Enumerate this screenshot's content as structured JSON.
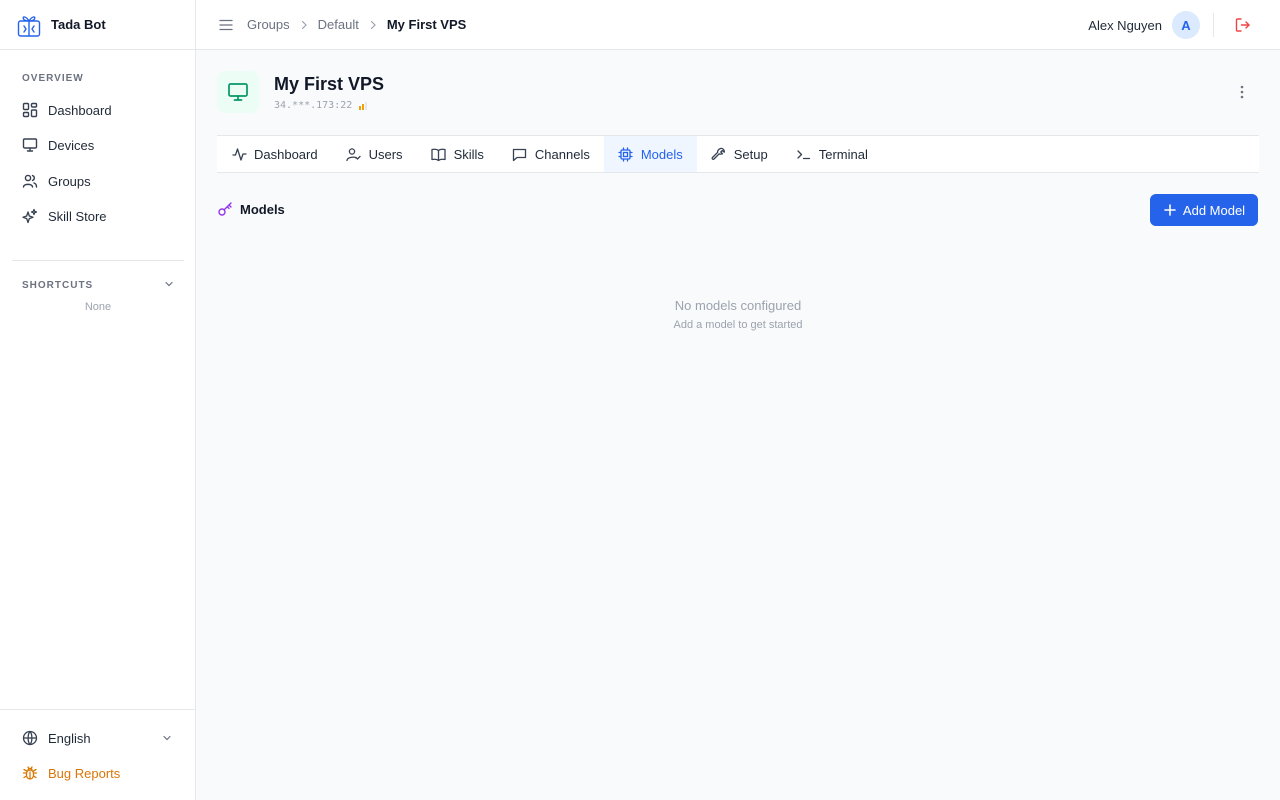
{
  "app": {
    "name": "Tada Bot"
  },
  "sidebar": {
    "overview_label": "OVERVIEW",
    "items": [
      {
        "label": "Dashboard",
        "icon": "dashboard-grid-icon"
      },
      {
        "label": "Devices",
        "icon": "monitor-icon"
      },
      {
        "label": "Groups",
        "icon": "users-icon"
      },
      {
        "label": "Skill Store",
        "icon": "sparkles-icon"
      }
    ],
    "shortcuts_label": "SHORTCUTS",
    "shortcuts_empty": "None",
    "language": "English",
    "bug_reports": "Bug Reports",
    "bug_color": "#d97706"
  },
  "topbar": {
    "breadcrumbs": [
      "Groups",
      "Default",
      "My First VPS"
    ],
    "user_name": "Alex Nguyen",
    "avatar_initial": "A"
  },
  "device": {
    "title": "My First VPS",
    "ip": "34.***.173:22",
    "signal_color": "#f59e0b"
  },
  "tabs": [
    {
      "label": "Dashboard",
      "icon": "activity-icon",
      "active": false
    },
    {
      "label": "Users",
      "icon": "user-check-icon",
      "active": false
    },
    {
      "label": "Skills",
      "icon": "book-icon",
      "active": false
    },
    {
      "label": "Channels",
      "icon": "message-square-icon",
      "active": false
    },
    {
      "label": "Models",
      "icon": "cpu-icon",
      "active": true
    },
    {
      "label": "Setup",
      "icon": "wrench-icon",
      "active": false
    },
    {
      "label": "Terminal",
      "icon": "terminal-icon",
      "active": false
    }
  ],
  "models": {
    "section_title": "Models",
    "add_button": "Add Model",
    "empty_title": "No models configured",
    "empty_subtitle": "Add a model to get started"
  },
  "colors": {
    "accent": "#2563eb",
    "device_icon": "#059669",
    "models_icon": "#9333ea",
    "logout": "#ef4444"
  }
}
